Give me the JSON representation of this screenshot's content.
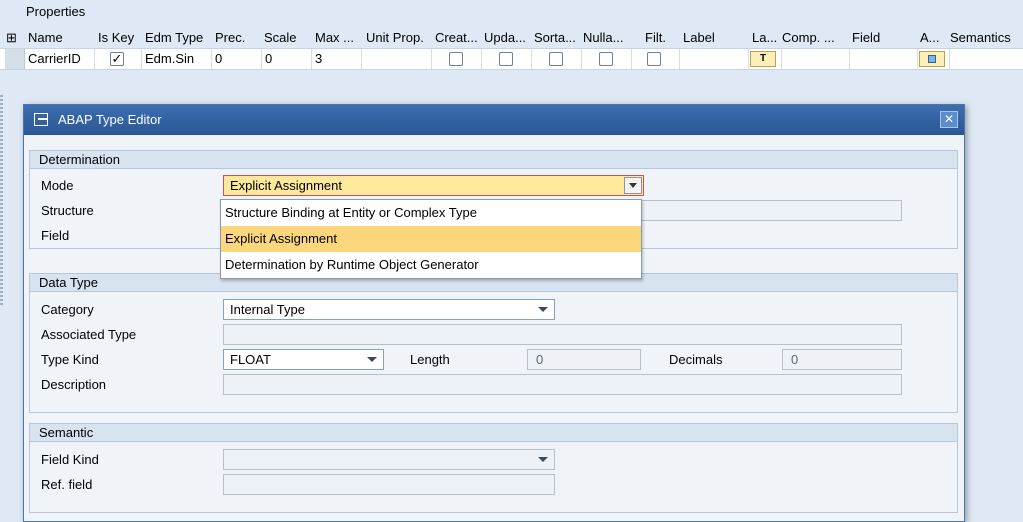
{
  "properties_title": "Properties",
  "grid": {
    "columns": [
      "Name",
      "Is Key",
      "Edm Type",
      "Prec.",
      "Scale",
      "Max ...",
      "Unit Prop.",
      "Creat...",
      "Upda...",
      "Sorta...",
      "Nulla...",
      "Filt.",
      "Label",
      "La...",
      "Comp. ...",
      "Field",
      "A...",
      "Semantics"
    ],
    "row": {
      "name": "CarrierID",
      "is_key": true,
      "edm_type": "Edm.Sin",
      "prec": "0",
      "scale": "0",
      "max": "3",
      "label_button": "T"
    }
  },
  "dialog": {
    "title": "ABAP Type Editor",
    "close_label": "✕",
    "determination": {
      "header": "Determination",
      "mode_label": "Mode",
      "mode_value": "Explicit Assignment",
      "structure_label": "Structure",
      "field_label": "Field",
      "options": [
        "Structure Binding at Entity or Complex Type",
        "Explicit Assignment",
        "Determination by Runtime Object Generator"
      ],
      "selected_option": "Explicit Assignment"
    },
    "data_type": {
      "header": "Data Type",
      "category_label": "Category",
      "category_value": "Internal Type",
      "associated_type_label": "Associated Type",
      "type_kind_label": "Type Kind",
      "type_kind_value": "FLOAT",
      "length_label": "Length",
      "length_value": "0",
      "decimals_label": "Decimals",
      "decimals_value": "0",
      "description_label": "Description"
    },
    "semantic": {
      "header": "Semantic",
      "field_kind_label": "Field Kind",
      "ref_field_label": "Ref. field"
    }
  }
}
